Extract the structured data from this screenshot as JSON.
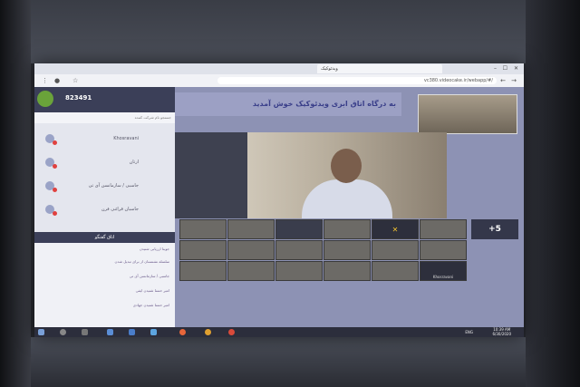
{
  "browser": {
    "tab_title": "ویدئوکیک",
    "url": "vc380.videocake.ir/webapp/#/",
    "lang": "ENG"
  },
  "sidebar": {
    "room_id": "823491",
    "search_placeholder": "جستجو نام شرکت کننده",
    "users": [
      {
        "name": "Khosravani"
      },
      {
        "name": "ارتان"
      },
      {
        "name": "جاسبی / سازمانسن آی تی"
      },
      {
        "name": "جاسبان قرائنی فرن"
      }
    ],
    "chat_title": "اتاق گفتگو",
    "messages": [
      "جوینا ارزیابی شنیدن",
      "سلسله نشنسنان از برای تبدیل شدن",
      "جاسبی / سازمانسن آی تی",
      "امیر حسنا شنیدن ایفی",
      "امیر حسنا شنیدن جهادی"
    ]
  },
  "video": {
    "banner": "به درگاه اتاق ابری ویدئوکیک خوش آمدید",
    "overflow_count": "+5",
    "placeholder_label": "Khosravani"
  },
  "taskbar": {
    "time": "10:39 AM",
    "date": "6/30/2020"
  }
}
